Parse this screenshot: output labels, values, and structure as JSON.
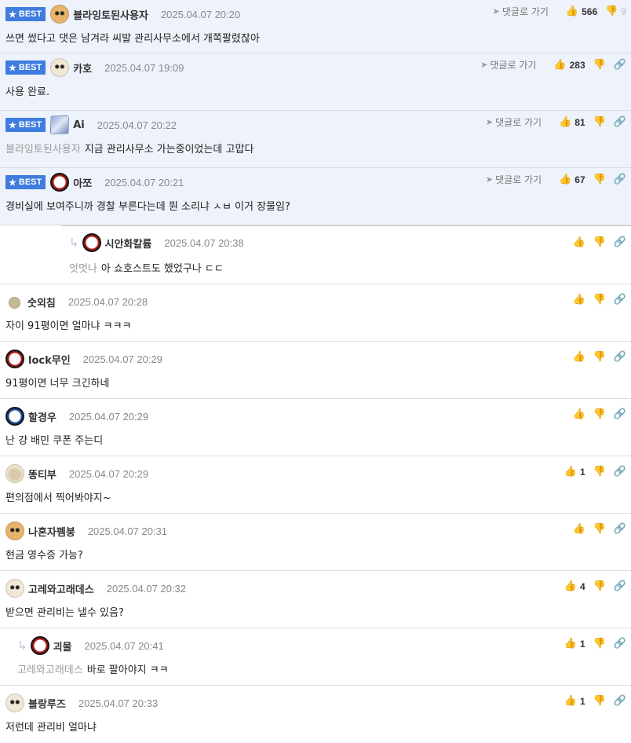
{
  "actions": {
    "goto_label": "댓글로 가기",
    "best_label": "BEST"
  },
  "comments": [
    {
      "nick": "블라잉토된사용자",
      "date": "2025.04.07 20:20",
      "text": "쓰면 썼다고 댓은 남겨라 씨발 관리사무소에서 개쪽팔렸잖아",
      "up": "566",
      "down": "9",
      "best": true
    },
    {
      "nick": "카호",
      "date": "2025.04.07 19:09",
      "text": "사용 완료.",
      "up": "283",
      "best": true
    },
    {
      "nick": "Ai",
      "date": "2025.04.07 20:22",
      "mention": "블라잉토된사용자",
      "text": "지금 관리사무소 가는중이었는데 고맙다",
      "up": "81",
      "best": true
    },
    {
      "nick": "아쪼",
      "date": "2025.04.07 20:21",
      "text": "경비실에 보여주니까 경찰 부른다는데 뭔 소리냐 ㅅㅂ 이거 장물임?",
      "up": "67",
      "best": true
    },
    {
      "nick": "시안화칼륨",
      "date": "2025.04.07 20:38",
      "mention": "엇멋나",
      "text": "아 쇼호스트도 했었구나 ㄷㄷ"
    },
    {
      "nick": "숫외침",
      "date": "2025.04.07 20:28",
      "text": "자이 91평이면 얼마냐 ㅋㅋㅋ"
    },
    {
      "nick": "lock무인",
      "date": "2025.04.07 20:29",
      "text": "91평이면 너무 크긴하네"
    },
    {
      "nick": "할경우",
      "date": "2025.04.07 20:29",
      "text": "난 걍 배민 쿠폰 주는디"
    },
    {
      "nick": "똥티부",
      "date": "2025.04.07 20:29",
      "text": "편의점에서 찍어봐야지~",
      "up": "1"
    },
    {
      "nick": "나혼자펨붕",
      "date": "2025.04.07 20:31",
      "text": "현금 영수증 가능?"
    },
    {
      "nick": "고레와고래데스",
      "date": "2025.04.07 20:32",
      "text": "받으면 관리비는 낼수 있음?",
      "up": "4"
    },
    {
      "nick": "괴물",
      "date": "2025.04.07 20:41",
      "mention": "고레와고래데스",
      "text": "바로 팔아야지 ㅋㅋ",
      "up": "1"
    },
    {
      "nick": "블랑루즈",
      "date": "2025.04.07 20:33",
      "text": "저런데 관리비 얼마냐",
      "up": "1"
    }
  ]
}
